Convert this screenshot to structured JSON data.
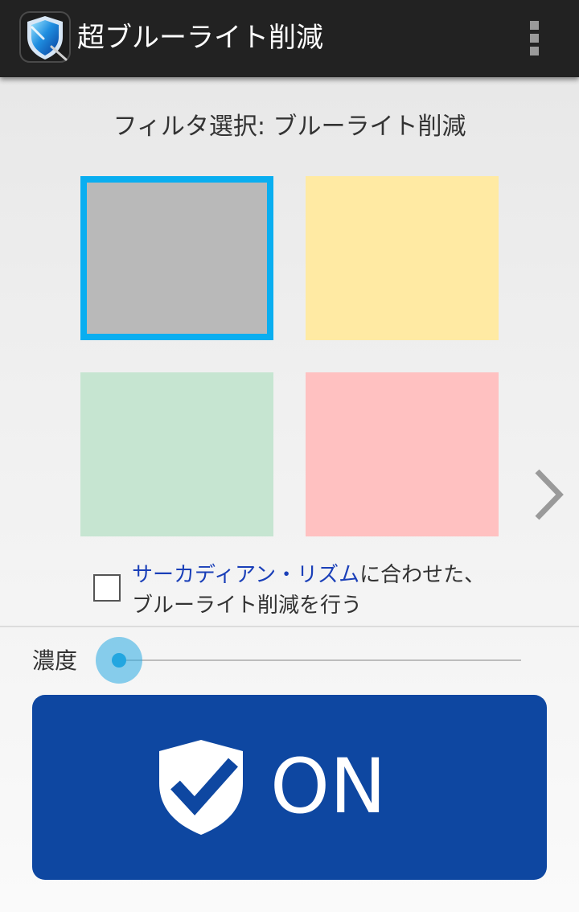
{
  "app": {
    "title": "超ブルーライト削減",
    "icon": "shield-app-icon",
    "menu_icon": "overflow-menu-icon"
  },
  "filter": {
    "title": "フィルタ選択: ブルーライト削減",
    "swatches": [
      {
        "color": "#b9b9b9",
        "selected": true
      },
      {
        "color": "#ffeaa3",
        "selected": false
      },
      {
        "color": "#c6e5d1",
        "selected": false
      },
      {
        "color": "#ffc1c1",
        "selected": false
      }
    ],
    "selected_border_color": "#09aef0",
    "next_icon": "chevron-right-icon"
  },
  "circadian": {
    "checked": false,
    "link_text": "サーカディアン・リズム",
    "text_suffix": "に合わせた、",
    "text_line2": "ブルーライト削減を行う"
  },
  "density": {
    "label": "濃度",
    "value_fraction": 0.0
  },
  "power_button": {
    "label": "ON",
    "icon": "shield-check-icon",
    "color": "#0e47a1"
  }
}
